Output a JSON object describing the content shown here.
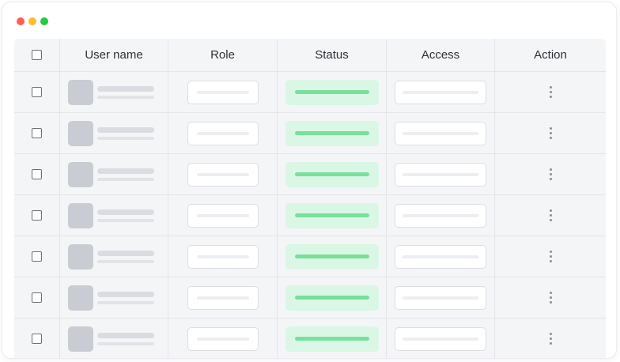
{
  "window": {
    "controls": [
      {
        "name": "close",
        "color": "#ff5f57"
      },
      {
        "name": "minimize",
        "color": "#febc2e"
      },
      {
        "name": "maximize",
        "color": "#28c840"
      }
    ]
  },
  "table": {
    "columns": [
      "User name",
      "Role",
      "Status",
      "Access",
      "Action"
    ],
    "status_color": "#78df9c",
    "row_count": 7
  },
  "icons": {
    "checkbox": "checkbox-icon",
    "avatar": "avatar-placeholder",
    "action": "more-vertical-icon"
  }
}
